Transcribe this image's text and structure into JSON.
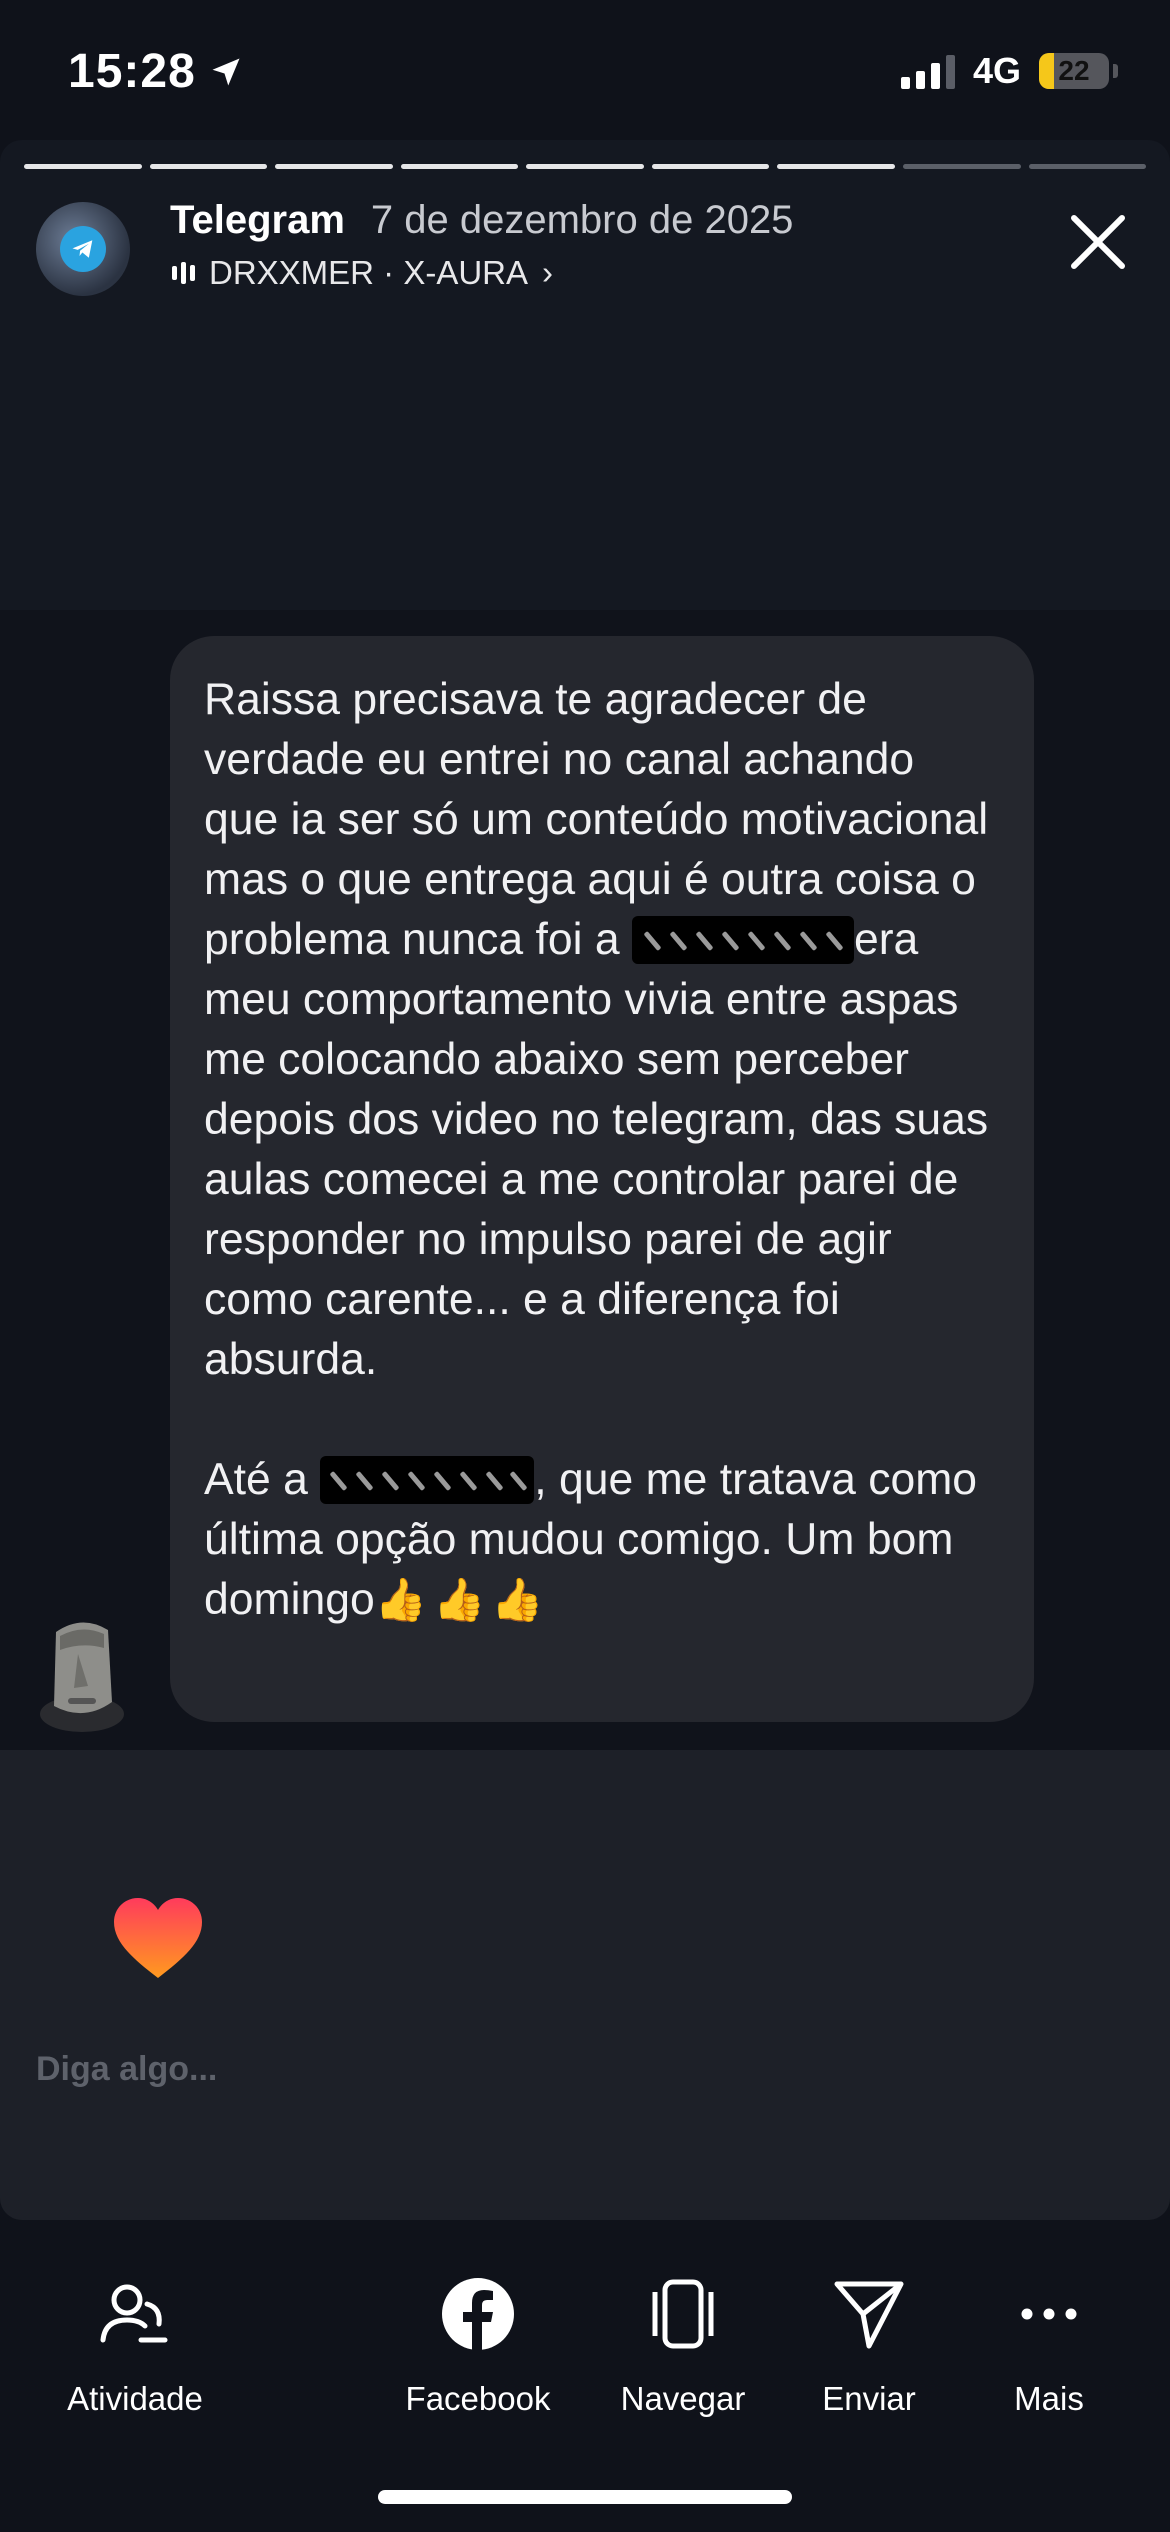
{
  "status_bar": {
    "time": "15:28",
    "network": "4G",
    "battery": "22",
    "battery_level_percent": 22
  },
  "story": {
    "progress": {
      "total_segments": 9,
      "completed_segments": 7
    },
    "header": {
      "app_name": "Telegram",
      "date": "7 de dezembro de 2025",
      "music": "DRXXMER · X-AURA",
      "music_chevron": "›"
    },
    "message": {
      "p1_before": "Raissa precisava te agradecer de verdade eu entrei no canal achando que ia ser só um conteúdo motivacional mas o que entrega aqui é outra coisa o problema nunca foi a",
      "p1_after": "era meu comportamento vivia entre aspas me colocando abaixo sem perceber depois dos video no telegram, das suas aulas comecei a me controlar parei de responder no impulso parei de agir como carente... e a diferença foi absurda.",
      "p2_before": "Até a",
      "p2_after": ", que me tratava como última opção  mudou comigo. Um bom domingo",
      "thumbs": "👍👍👍"
    },
    "reply_placeholder": "Diga algo..."
  },
  "actions": [
    {
      "label": "Atividade",
      "icon": "activity-icon"
    },
    {
      "label": "Facebook",
      "icon": "facebook-icon"
    },
    {
      "label": "Navegar",
      "icon": "browse-icon"
    },
    {
      "label": "Enviar",
      "icon": "send-icon"
    },
    {
      "label": "Mais",
      "icon": "more-icon"
    }
  ],
  "colors": {
    "background": "#0f121a",
    "bubble": "#25272e",
    "heart_top": "#ff3b5c",
    "heart_bottom": "#ff9a1f",
    "battery": "#f5c71a"
  }
}
